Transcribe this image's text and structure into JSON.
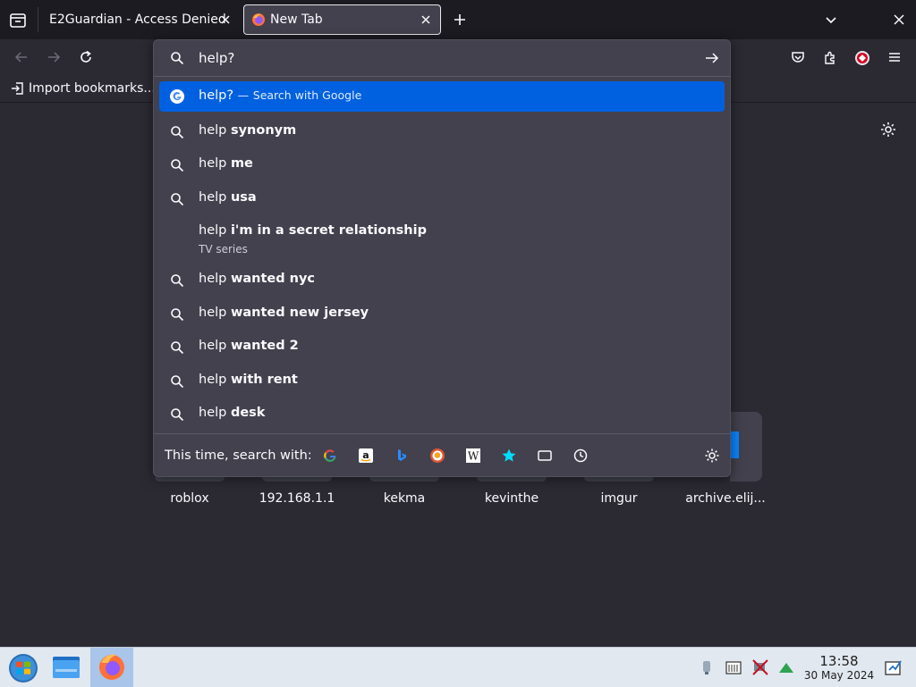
{
  "tabs": [
    {
      "title": "E2Guardian - Access Denied",
      "active": false
    },
    {
      "title": "New Tab",
      "active": true
    }
  ],
  "bookmarks": {
    "import_label": "Import bookmarks..."
  },
  "urlbar": {
    "value": "help?",
    "results": [
      {
        "prefix": "help?",
        "bold": "",
        "action": "Search with Google",
        "sub": "",
        "icon": "google-icon"
      },
      {
        "prefix": "help ",
        "bold": "synonym",
        "sub": "",
        "icon": "search-icon"
      },
      {
        "prefix": "help ",
        "bold": "me",
        "sub": "",
        "icon": "search-icon"
      },
      {
        "prefix": "help ",
        "bold": "usa",
        "sub": "",
        "icon": "search-icon"
      },
      {
        "prefix": "help ",
        "bold": "i'm in a secret relationship",
        "sub": "TV series",
        "icon": ""
      },
      {
        "prefix": "help ",
        "bold": "wanted nyc",
        "sub": "",
        "icon": "search-icon"
      },
      {
        "prefix": "help ",
        "bold": "wanted new jersey",
        "sub": "",
        "icon": "search-icon"
      },
      {
        "prefix": "help ",
        "bold": "wanted 2",
        "sub": "",
        "icon": "search-icon"
      },
      {
        "prefix": "help ",
        "bold": "with rent",
        "sub": "",
        "icon": "search-icon"
      },
      {
        "prefix": "help ",
        "bold": "desk",
        "sub": "",
        "icon": "search-icon"
      }
    ],
    "result_separator": "—",
    "engine_label": "This time, search with:",
    "engines": [
      "google-icon",
      "amazon-icon",
      "bing-icon",
      "duckduckgo-icon",
      "wikipedia-icon",
      "bookmarks-star-icon",
      "tabs-icon",
      "history-clock-icon"
    ]
  },
  "shortcuts": [
    "roblox",
    "192.168.1.1",
    "kekma",
    "kevinthe",
    "imgur",
    "archive.elij..."
  ],
  "taskbar": {
    "time": "13:58",
    "date": "30 May 2024"
  },
  "colors": {
    "accent": "#0061e0",
    "popup_bg": "#42414d",
    "chrome_bg": "#1c1b22",
    "page_bg": "#2b2a33"
  }
}
